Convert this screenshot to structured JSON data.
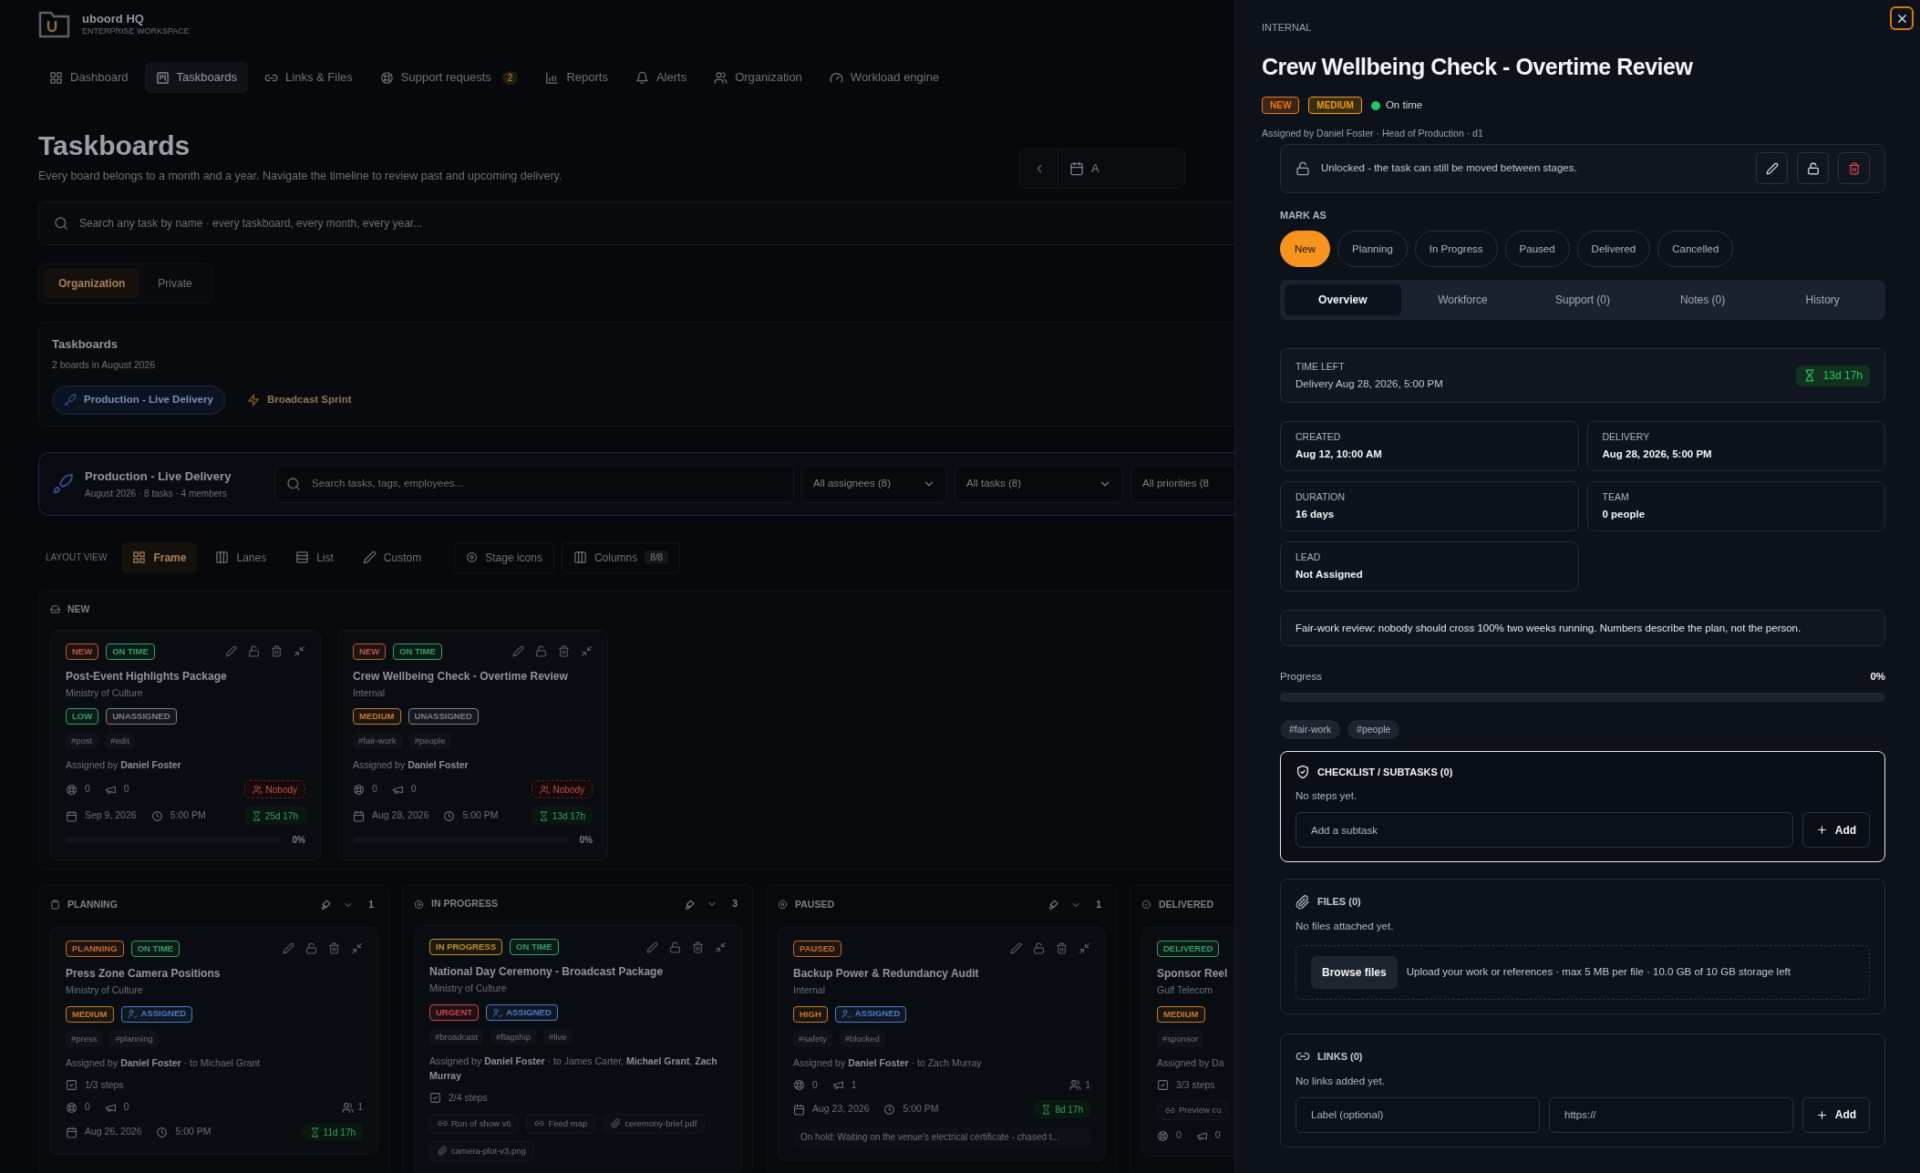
{
  "app": {
    "name": "uboord HQ",
    "subtitle": "ENTERPRISE WORKSPACE"
  },
  "nav": [
    {
      "label": "Dashboard",
      "selected": false
    },
    {
      "label": "Taskboards",
      "selected": true
    },
    {
      "label": "Links & Files",
      "selected": false
    },
    {
      "label": "Support requests",
      "selected": false,
      "badge": "2"
    },
    {
      "label": "Reports",
      "selected": false
    },
    {
      "label": "Alerts",
      "selected": false
    },
    {
      "label": "Organization",
      "selected": false
    },
    {
      "label": "Workload engine",
      "selected": false
    }
  ],
  "page": {
    "title": "Taskboards",
    "subtitle": "Every board belongs to a month and a year. Navigate the timeline to review past and upcoming delivery.",
    "date_button": "A"
  },
  "search": {
    "placeholder": "Search any task by name · every taskboard, every month, every year..."
  },
  "scope_tabs": [
    {
      "label": "Organization",
      "selected": true
    },
    {
      "label": "Private",
      "selected": false
    }
  ],
  "taskboards": {
    "title": "Taskboards",
    "subtitle": "2 boards in August 2026",
    "boards": [
      {
        "label": "Production - Live Delivery",
        "selected": true
      },
      {
        "label": "Broadcast Sprint",
        "selected": false
      }
    ]
  },
  "board": {
    "title": "Production - Live Delivery",
    "meta": "August 2026 · 8 tasks · 4 members",
    "search_placeholder": "Search tasks, tags, employees...",
    "filters": [
      "All assignees (8)",
      "All tasks (8)",
      "All priorities (8"
    ]
  },
  "layout_view": {
    "label": "LAYOUT VIEW",
    "options": [
      {
        "label": "Frame",
        "selected": true
      },
      {
        "label": "Lanes",
        "selected": false
      },
      {
        "label": "List",
        "selected": false
      },
      {
        "label": "Custom",
        "selected": false
      }
    ],
    "stage_icons": "Stage icons",
    "columns": "Columns",
    "columns_count": "8/8"
  },
  "new_stage": {
    "name": "NEW",
    "cards": [
      {
        "badges": [
          {
            "text": "NEW",
            "color": "#c0583a"
          },
          {
            "text": "ON TIME",
            "color": "#34a065"
          }
        ],
        "title": "Post-Event Highlights Package",
        "client": "Ministry of Culture",
        "labels": [
          {
            "text": "LOW",
            "color": "#34a065",
            "kind": "plain"
          },
          {
            "text": "UNASSIGNED",
            "color": "#7c828b",
            "kind": "plain"
          }
        ],
        "tags": [
          "#post",
          "#edit"
        ],
        "assignment": "Assigned by **Daniel Foster**",
        "support": "0",
        "comments": "0",
        "nobody": "Nobody",
        "date": "Sep 9, 2026",
        "time": "5:00 PM",
        "remaining": "25d 17h",
        "progress": {
          "level": 0,
          "reading": "0%"
        }
      },
      {
        "badges": [
          {
            "text": "NEW",
            "color": "#c0583a"
          },
          {
            "text": "ON TIME",
            "color": "#34a065"
          }
        ],
        "title": "Crew Wellbeing Check - Overtime Review",
        "client": "Internal",
        "labels": [
          {
            "text": "MEDIUM",
            "color": "#c77a2a",
            "kind": "plain"
          },
          {
            "text": "UNASSIGNED",
            "color": "#7c828b",
            "kind": "plain"
          }
        ],
        "tags": [
          "#fair-work",
          "#people"
        ],
        "assignment": "Assigned by **Daniel Foster**",
        "support": "0",
        "comments": "0",
        "nobody": "Nobody",
        "date": "Aug 28, 2026",
        "time": "5:00 PM",
        "remaining": "13d 17h",
        "progress": {
          "level": 0,
          "reading": "0%"
        }
      }
    ]
  },
  "stages": [
    {
      "name": "PLANNING",
      "count": "1",
      "cards": [
        {
          "badges": [
            {
              "text": "PLANNING",
              "color": "#c76a2a"
            },
            {
              "text": "ON TIME",
              "color": "#34a065"
            }
          ],
          "title": "Press Zone Camera Positions",
          "client": "Ministry of Culture",
          "labels": [
            {
              "text": "MEDIUM",
              "color": "#c77a2a",
              "kind": "plain"
            },
            {
              "text": "ASSIGNED",
              "color": "#4a7cc8",
              "kind": "assigned"
            }
          ],
          "tags": [
            "#press",
            "#planning"
          ],
          "assignment": "Assigned by **Daniel Foster** · to Michael Grant",
          "steps": "1/3 steps",
          "support": "0",
          "comments": "0",
          "people": "1",
          "date": "Aug 26, 2026",
          "time": "5:00 PM",
          "remaining": "11d 17h"
        }
      ]
    },
    {
      "name": "IN PROGRESS",
      "count": "3",
      "cards": [
        {
          "badges": [
            {
              "text": "IN PROGRESS",
              "color": "#c78f2a"
            },
            {
              "text": "ON TIME",
              "color": "#34a065"
            }
          ],
          "title": "National Day Ceremony - Broadcast Package",
          "client": "Ministry of Culture",
          "labels": [
            {
              "text": "URGENT",
              "color": "#c84444",
              "kind": "plain"
            },
            {
              "text": "ASSIGNED",
              "color": "#4a7cc8",
              "kind": "assigned"
            }
          ],
          "tags": [
            "#broadcast",
            "#flagship",
            "#live"
          ],
          "assignment": "Assigned by **Daniel Foster** · to James Carter, **Michael Grant**, **Zach Murray**",
          "steps": "2/4 steps",
          "attachments": [
            {
              "kind": "link",
              "text": "Run of show v6"
            },
            {
              "kind": "link",
              "text": "Feed map"
            },
            {
              "kind": "file",
              "text": "ceremony-brief.pdf"
            },
            {
              "kind": "file",
              "text": "camera-plot-v3.png"
            }
          ]
        }
      ]
    },
    {
      "name": "PAUSED",
      "count": "1",
      "cards": [
        {
          "badges": [
            {
              "text": "PAUSED",
              "color": "#c76a2a"
            }
          ],
          "title": "Backup Power & Redundancy Audit",
          "client": "Internal",
          "labels": [
            {
              "text": "HIGH",
              "color": "#c77a2a",
              "kind": "plain"
            },
            {
              "text": "ASSIGNED",
              "color": "#4a7cc8",
              "kind": "assigned"
            }
          ],
          "tags": [
            "#safety",
            "#blocked"
          ],
          "assignment": "Assigned by **Daniel Foster** · to Zach Murray",
          "support": "0",
          "comments": "1",
          "people": "1",
          "date": "Aug 23, 2026",
          "time": "5:00 PM",
          "remaining": "8d 17h",
          "note": "On hold: Waiting on the venue's electrical certificate - chased t..."
        }
      ]
    },
    {
      "name": "DELIVERED",
      "cards": [
        {
          "badges": [
            {
              "text": "DELIVERED",
              "color": "#34a065"
            }
          ],
          "title": "Sponsor Reel",
          "client": "Gulf Telecom",
          "labels": [
            {
              "text": "MEDIUM",
              "color": "#c77a2a",
              "kind": "plain"
            }
          ],
          "tags": [
            "#sponsor"
          ],
          "assignment": "Assigned by Da",
          "steps": "3/3 steps",
          "attachments": [
            {
              "kind": "link",
              "text": "Preview cu"
            }
          ],
          "support": "0",
          "comments": "0"
        }
      ]
    }
  ],
  "drawer": {
    "client": "INTERNAL",
    "title": "Crew Wellbeing Check - Overtime Review",
    "badges": [
      {
        "text": "NEW",
        "color": "#f97316"
      },
      {
        "text": "MEDIUM",
        "color": "#f59e0b"
      }
    ],
    "timing": {
      "label": "On time",
      "color": "#22c55e"
    },
    "assigned": "Assigned by Daniel Foster · Head of Production · d1",
    "lock": {
      "locked": false,
      "text": "Unlocked - the task can still be moved between stages."
    },
    "mark_as": {
      "label": "MARK AS",
      "options": [
        {
          "label": "New",
          "selected": true
        },
        {
          "label": "Planning",
          "selected": false
        },
        {
          "label": "In Progress",
          "selected": false
        },
        {
          "label": "Paused",
          "selected": false
        },
        {
          "label": "Delivered",
          "selected": false
        },
        {
          "label": "Cancelled",
          "selected": false
        }
      ]
    },
    "tabs": [
      {
        "label": "Overview",
        "selected": true
      },
      {
        "label": "Workforce",
        "selected": false
      },
      {
        "label": "Support (0)",
        "selected": false
      },
      {
        "label": "Notes (0)",
        "selected": false
      },
      {
        "label": "History",
        "selected": false
      }
    ],
    "time_left": {
      "label": "TIME LEFT",
      "value": "Delivery Aug 28, 2026, 5:00 PM",
      "remaining": "13d 17h"
    },
    "facts": [
      {
        "label": "CREATED",
        "value": "Aug 12, 10:00 AM"
      },
      {
        "label": "DELIVERY",
        "value": "Aug 28, 2026, 5:00 PM"
      },
      {
        "label": "DURATION",
        "value": "16 days"
      },
      {
        "label": "TEAM",
        "value": "0 people"
      },
      {
        "label": "LEAD",
        "value": "Not Assigned"
      }
    ],
    "note": "Fair-work review: nobody should cross 100% two weeks running. Numbers describe the plan, not the person.",
    "progress": {
      "label": "Progress",
      "reading": "0%",
      "level": 0
    },
    "tags": [
      "#fair-work",
      "#people"
    ],
    "checklist": {
      "title": "CHECKLIST / SUBTASKS (0)",
      "empty": "No steps yet.",
      "placeholder": "Add a subtask",
      "button": "Add"
    },
    "files": {
      "title": "FILES (0)",
      "empty": "No files attached yet.",
      "button": "Browse files",
      "hint": "Upload your work or references · max 5 MB per file · 10.0 GB of 10 GB storage left"
    },
    "links": {
      "title": "LINKS (0)",
      "empty": "No links added yet.",
      "label_placeholder": "Label (optional)",
      "url_placeholder": "https://",
      "button": "Add"
    }
  }
}
